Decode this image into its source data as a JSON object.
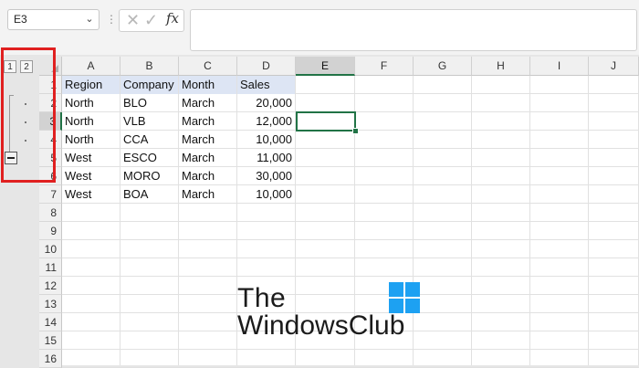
{
  "formula_bar": {
    "name_box_value": "E3",
    "name_box_arrow_icon": "chevron-down-icon",
    "more_icon": "⋮",
    "cancel_icon": "✕",
    "enter_icon": "✓",
    "fx_label": "fx",
    "formula_value": ""
  },
  "outline": {
    "level_buttons": [
      "1",
      "2"
    ],
    "collapse_button": "minus-icon",
    "highlight_color": "#e02020"
  },
  "columns": [
    "A",
    "B",
    "C",
    "D",
    "E",
    "F",
    "G",
    "H",
    "I",
    "J"
  ],
  "rows": [
    "1",
    "2",
    "3",
    "4",
    "5",
    "6",
    "7",
    "8",
    "9",
    "10",
    "11",
    "12",
    "13",
    "14",
    "15",
    "16"
  ],
  "selected_cell": "E3",
  "table": {
    "headers": [
      "Region",
      "Company",
      "Month",
      "Sales"
    ],
    "rows": [
      [
        "North",
        "BLO",
        "March",
        "20,000"
      ],
      [
        "North",
        "VLB",
        "March",
        "12,000"
      ],
      [
        "North",
        "CCA",
        "March",
        "10,000"
      ],
      [
        "West",
        "ESCO",
        "March",
        "11,000"
      ],
      [
        "West",
        "MORO",
        "March",
        "30,000"
      ],
      [
        "West",
        "BOA",
        "March",
        "10,000"
      ]
    ]
  },
  "watermark": {
    "line1": "The",
    "line2": "WindowsClub",
    "logo_color": "#1da1f2"
  },
  "colors": {
    "accent": "#217346",
    "header_fill": "#dde5f4"
  }
}
